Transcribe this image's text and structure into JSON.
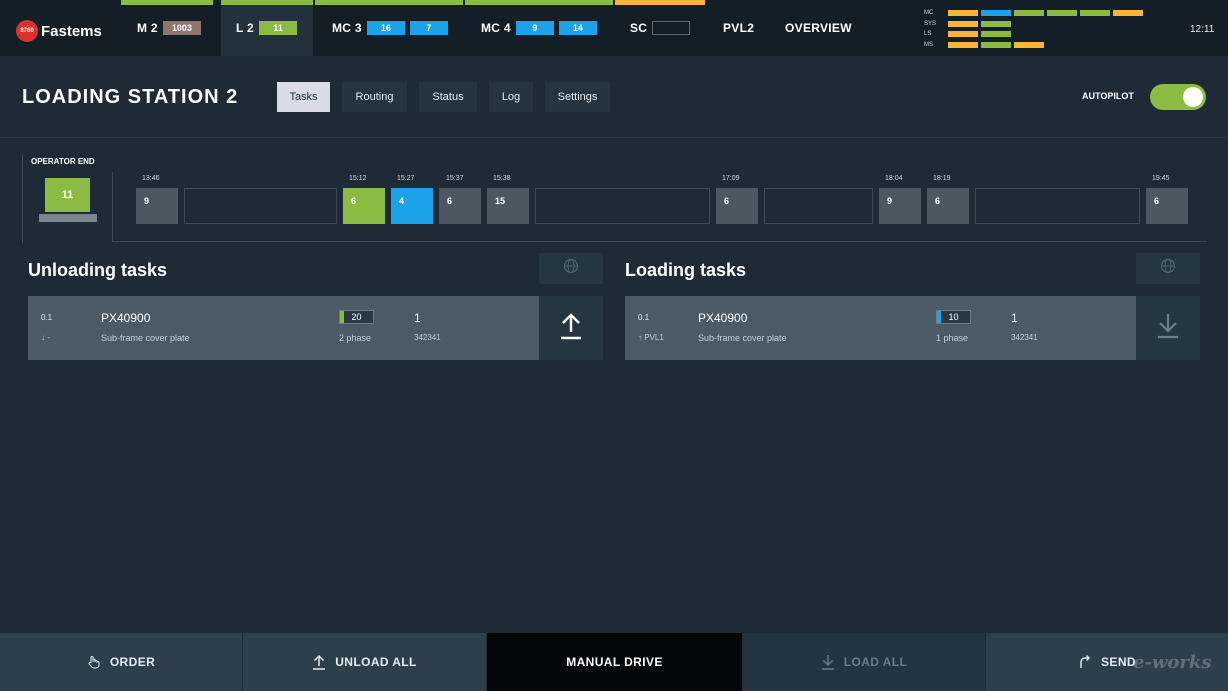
{
  "app": {
    "logo_badge": "8760",
    "logo_text": "Fastems",
    "clock": "12:11"
  },
  "stations": [
    {
      "name": "M 2",
      "chips": [
        "1003"
      ],
      "stripe": "#8cbb44",
      "active": false
    },
    {
      "name": "L 2",
      "chips": [
        "11"
      ],
      "stripe": "#8cbb44",
      "active": true
    },
    {
      "name": "MC 3",
      "chips": [
        "16",
        "7"
      ],
      "stripe": "#8cbb44",
      "active": false
    },
    {
      "name": "MC 4",
      "chips": [
        "9",
        "14"
      ],
      "stripe": "#8cbb44",
      "active": false
    },
    {
      "name": "SC",
      "chips": [
        ""
      ],
      "stripe": "#f6b53a",
      "active": false
    },
    {
      "name": "PVL2"
    },
    {
      "name": "OVERVIEW"
    }
  ],
  "status_grid": {
    "rows": [
      {
        "label": "MC",
        "bars": [
          "#f6b53a",
          "#1ba2e8",
          "#8cbb44",
          "#8cbb44",
          "#8cbb44",
          "#f6b53a"
        ]
      },
      {
        "label": "SYS",
        "bars": [
          "#f6b53a",
          "#8cbb44"
        ]
      },
      {
        "label": "LS",
        "bars": [
          "#f6b53a",
          "#8cbb44"
        ]
      },
      {
        "label": "MS",
        "bars": [
          "#f6b53a",
          "#8cbb44",
          "#f6b53a"
        ]
      }
    ]
  },
  "header": {
    "title": "LOADING STATION 2",
    "tabs": [
      "Tasks",
      "Routing",
      "Status",
      "Log",
      "Settings"
    ],
    "active_tab": "Tasks",
    "autopilot_label": "AUTOPILOT",
    "autopilot_on": true
  },
  "operator": {
    "label": "OPERATOR END",
    "value": "11"
  },
  "timeline": {
    "slots": [
      {
        "time": "13:46",
        "value": "9",
        "color": "gray"
      },
      {
        "time": "15:12",
        "value": "6",
        "color": "green"
      },
      {
        "time": "15:27",
        "value": "4",
        "color": "blue"
      },
      {
        "time": "15:37",
        "value": "6",
        "color": "gray"
      },
      {
        "time": "15:38",
        "value": "15",
        "color": "gray"
      },
      {
        "time": "17:09",
        "value": "6",
        "color": "gray"
      },
      {
        "time": "18:04",
        "value": "9",
        "color": "gray"
      },
      {
        "time": "18:19",
        "value": "6",
        "color": "gray"
      },
      {
        "time": "19:45",
        "value": "6",
        "color": "gray"
      }
    ]
  },
  "unloading": {
    "title": "Unloading tasks",
    "task": {
      "idx": "0.1",
      "sub": "↓ -",
      "code": "PX40900",
      "desc": "Sub-frame cover plate",
      "count": "20",
      "count_color": "#8cbb44",
      "phase": "2 phase",
      "qty": "1",
      "order": "342341"
    }
  },
  "loading": {
    "title": "Loading tasks",
    "task": {
      "idx": "0.1",
      "sub": "↑ PVL1",
      "code": "PX40900",
      "desc": "Sub-frame cover plate",
      "count": "10",
      "count_color": "#1ba2e8",
      "phase": "1 phase",
      "qty": "1",
      "order": "342341"
    }
  },
  "bottom": {
    "order": "ORDER",
    "unload_all": "UNLOAD ALL",
    "manual_drive": "MANUAL DRIVE",
    "load_all": "LOAD ALL",
    "send": "SEND"
  },
  "watermark": "e-works"
}
